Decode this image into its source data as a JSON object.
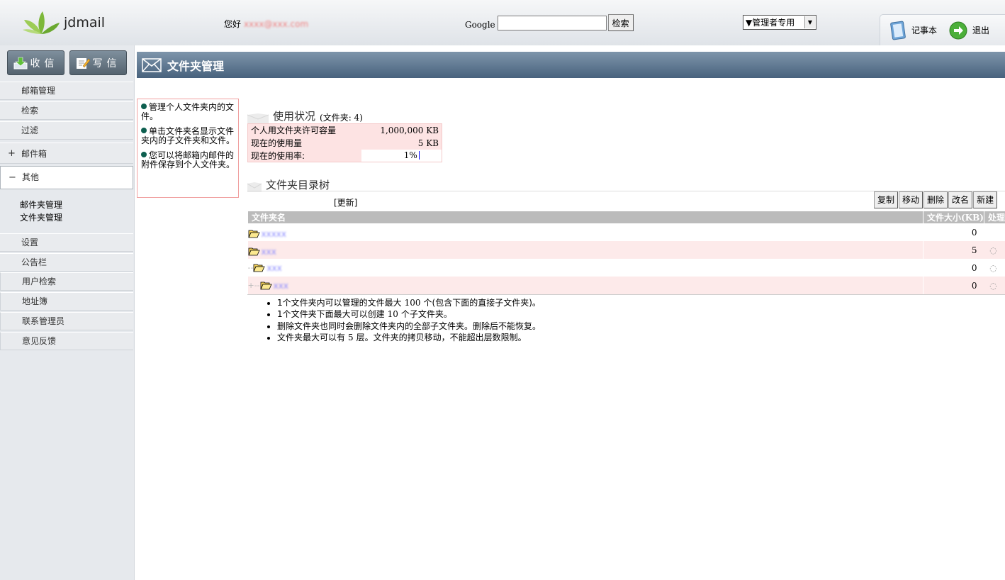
{
  "header": {
    "logo_text": "jdmail",
    "greeting_label": "您好",
    "greeting_user": "xxxx@xxx.com",
    "google_label": "Google",
    "search_button": "检索",
    "admin_select": "▼管理者专用",
    "notepad_label": "记事本",
    "logout_label": "退出"
  },
  "sidebar": {
    "receive_label": "收信",
    "compose_label": "写信",
    "items": [
      {
        "label": "邮箱管理"
      },
      {
        "label": "检索"
      },
      {
        "label": "过滤"
      },
      {
        "label": "邮件箱",
        "toggle": "+"
      },
      {
        "label": "其他",
        "toggle": "−"
      }
    ],
    "subitems": [
      "邮件夹管理",
      "文件夹管理"
    ],
    "items2": [
      {
        "label": "设置"
      },
      {
        "label": "公告栏"
      },
      {
        "label": "用户检索"
      },
      {
        "label": "地址簿"
      },
      {
        "label": "联系管理员"
      },
      {
        "label": "意见反馈"
      }
    ]
  },
  "main": {
    "title": "文件夹管理",
    "help": [
      "管理个人文件夹内的文件。",
      "单击文件夹名显示文件夹内的子文件夹和文件。",
      "您可以将邮箱内邮件的附件保存到个人文件夹。"
    ],
    "usage_title": "使用状况",
    "usage_folders": "(文件夹: 4)",
    "usage_rows": [
      {
        "label": "个人用文件夹许可容量",
        "value": "1,000,000 KB"
      },
      {
        "label": "现在的使用量",
        "value": "5 KB"
      },
      {
        "label": "现在的使用率:",
        "value": "1%"
      }
    ],
    "tree_title": "文件夹目录树",
    "refresh_label": "[更新]",
    "actions": [
      "复制",
      "移动",
      "删除",
      "改名",
      "新建"
    ],
    "col_name": "文件夹名",
    "col_size": "文件大小(KB)",
    "col_action": "处理",
    "folders": [
      {
        "prefix": "",
        "name": "xxxxx",
        "size": "0"
      },
      {
        "prefix": "",
        "name": "xxx",
        "size": "5"
      },
      {
        "prefix": "--",
        "name": "xxx",
        "size": "0"
      },
      {
        "prefix": "+--",
        "name": "xxx",
        "size": "0"
      }
    ],
    "notes": [
      {
        "pre": "1个文件夹内可以管理的文件最大",
        "num": "100",
        "post": "个(包含下面的直接子文件夹)。"
      },
      {
        "pre": "1个文件夹下面最大可以创建",
        "num": "10",
        "post": "个子文件夹。"
      },
      {
        "pre": "删除文件夹也同时会删除文件夹内的全部子文件夹。删除后不能恢复。",
        "num": "",
        "post": ""
      },
      {
        "pre": "文件夹最大可以有",
        "num": "5",
        "post": "层。文件夹的拷贝移动，不能超出层数限制。"
      }
    ]
  }
}
